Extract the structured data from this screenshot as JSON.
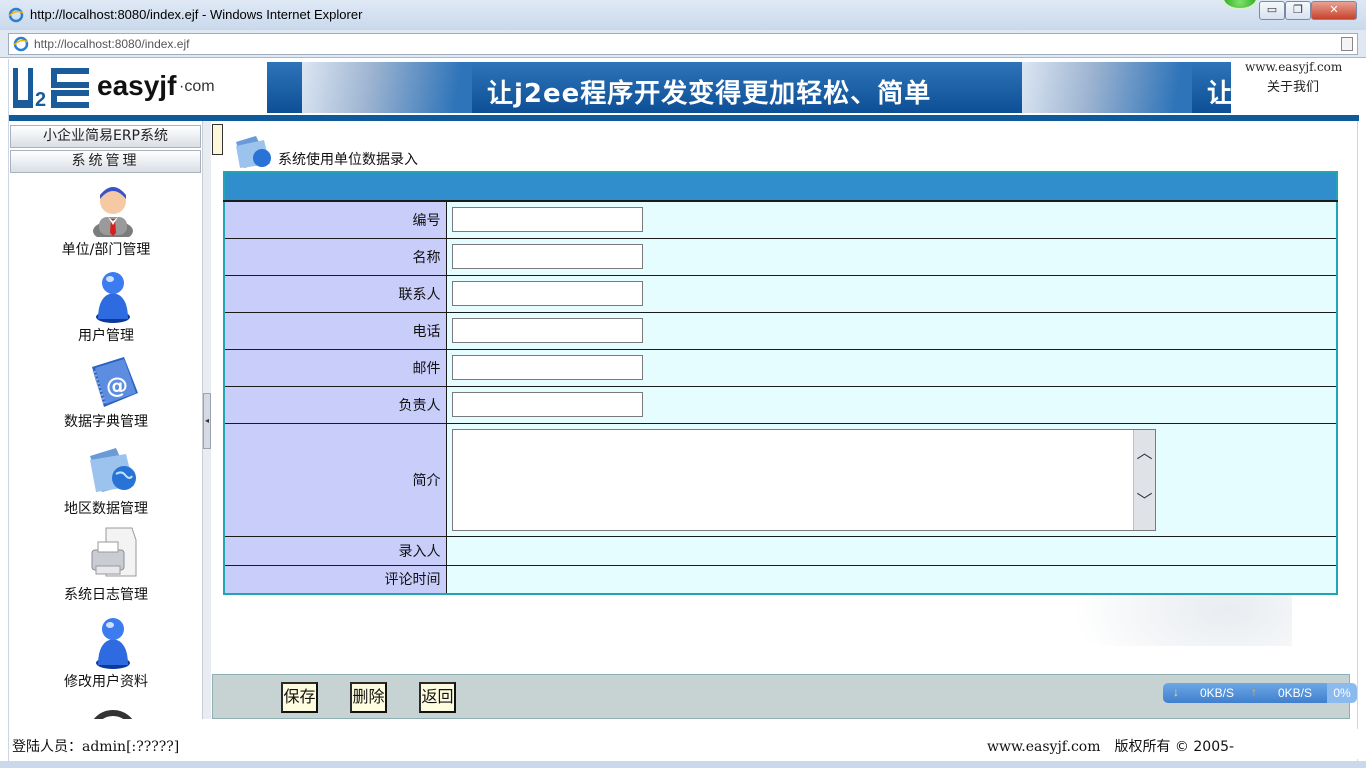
{
  "window": {
    "title": "http://localhost:8080/index.ejf - Windows Internet Explorer",
    "address": "http://localhost:8080/index.ejf",
    "min_glyph": "▭",
    "max_glyph": "❐",
    "close_glyph": "✕"
  },
  "banner": {
    "logo_text": "easyjf",
    "logo_com": "·com",
    "slogan": "让j2ee程序开发变得更加轻松、简单",
    "slogan_repeat": "让",
    "site_link": "www.easyjf.com",
    "about_link": "关于我们"
  },
  "sidebar": {
    "system_title": "小企业简易ERP系统",
    "section_title": "系统管理",
    "items": [
      {
        "label": "单位/部门管理",
        "icon": "manager-person-icon"
      },
      {
        "label": "用户管理",
        "icon": "user-person-icon"
      },
      {
        "label": "数据字典管理",
        "icon": "address-book-icon"
      },
      {
        "label": "地区数据管理",
        "icon": "folder-globe-icon"
      },
      {
        "label": "系统日志管理",
        "icon": "printer-icon"
      },
      {
        "label": "修改用户资料",
        "icon": "user-person-icon"
      }
    ]
  },
  "form": {
    "title": "系统使用单位数据录入",
    "fields": {
      "code": {
        "label": "编号",
        "value": ""
      },
      "name": {
        "label": "名称",
        "value": ""
      },
      "contact": {
        "label": "联系人",
        "value": ""
      },
      "phone": {
        "label": "电话",
        "value": ""
      },
      "email": {
        "label": "邮件",
        "value": ""
      },
      "manager": {
        "label": "负责人",
        "value": ""
      },
      "intro": {
        "label": "简介",
        "value": ""
      },
      "entered_by": {
        "label": "录入人",
        "value": ""
      },
      "comment_time": {
        "label": "评论时间",
        "value": ""
      }
    }
  },
  "buttons": {
    "save": "保存",
    "delete": "删除",
    "back": "返回"
  },
  "speed_meter": {
    "down": "0KB/S",
    "up": "0KB/S",
    "percent": "0%"
  },
  "footer": {
    "login_label": "登陆人员：",
    "login_user": "admin[:?????]",
    "site": "www.easyjf.com",
    "copyright": "版权所有 © 2005-"
  },
  "colors": {
    "form_header": "#2f8ecb",
    "label_cell": "#c8cdfa",
    "value_cell": "#e6fdff",
    "banner_blue": "#0f5a9b"
  }
}
